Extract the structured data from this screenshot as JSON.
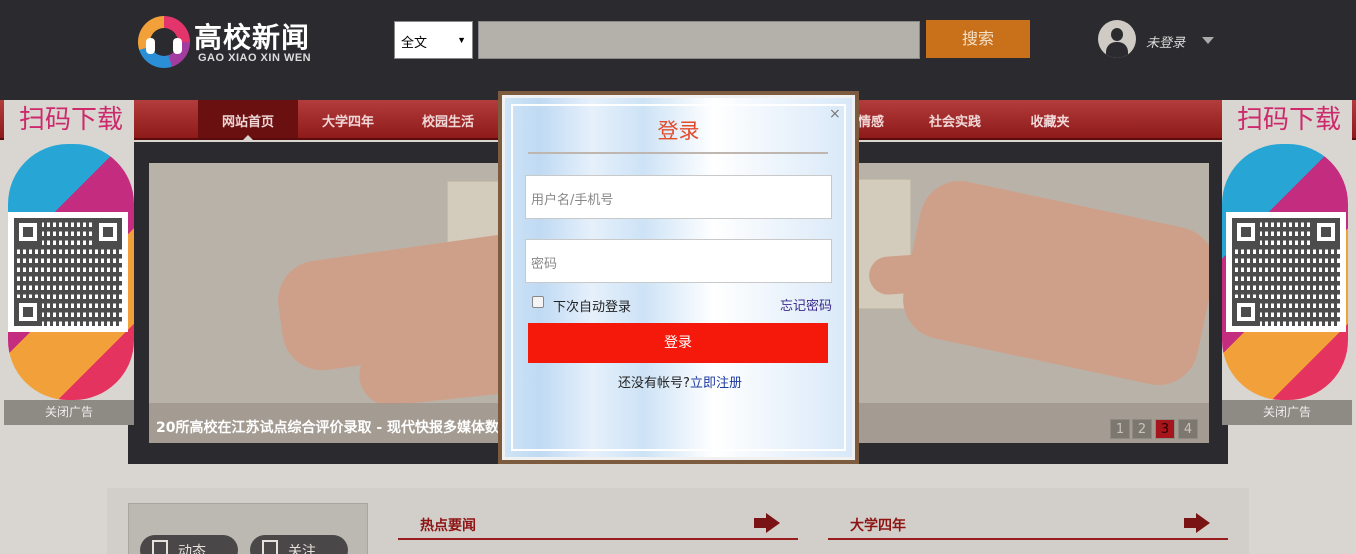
{
  "header": {
    "logo_title": "高校新闻",
    "logo_sub": "GAO XIAO XIN WEN",
    "search_scope": "全文",
    "search_value": "",
    "search_button": "搜索",
    "user_label": "未登录"
  },
  "nav": {
    "items": [
      "网站首页",
      "大学四年",
      "校园生活",
      "情感",
      "社会实践",
      "收藏夹"
    ]
  },
  "slider": {
    "caption": "20所高校在江苏试点综合评价录取 - 现代快报多媒体数",
    "pages": [
      "1",
      "2",
      "3",
      "4"
    ],
    "active_page": "3"
  },
  "ads": {
    "title": "扫码下载",
    "close": "关闭广告"
  },
  "content": {
    "tab_dynamic": "动态",
    "tab_follow": "关注",
    "section_hot": "热点要闻",
    "section_four_years": "大学四年"
  },
  "login": {
    "title": "登录",
    "close_glyph": "×",
    "username_placeholder": "用户名/手机号",
    "password_placeholder": "密码",
    "remember": "下次自动登录",
    "forgot": "忘记密码",
    "button": "登录",
    "register_prompt": "还没有帐号?",
    "register_link": "立即注册"
  }
}
